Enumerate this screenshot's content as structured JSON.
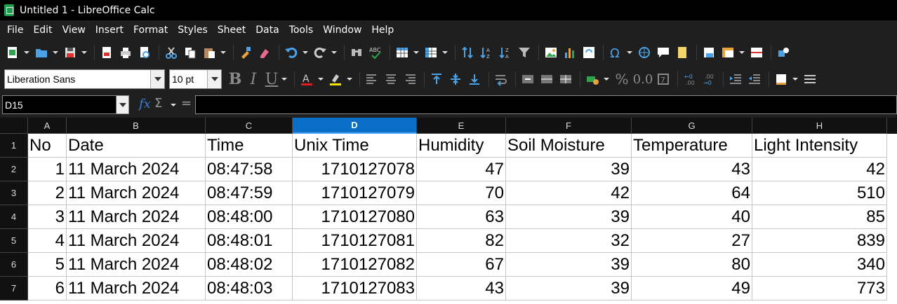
{
  "window": {
    "title": "Untitled 1 - LibreOffice Calc",
    "icon": "calc-icon"
  },
  "menu": [
    {
      "label": "File"
    },
    {
      "label": "Edit"
    },
    {
      "label": "View"
    },
    {
      "label": "Insert"
    },
    {
      "label": "Format"
    },
    {
      "label": "Styles"
    },
    {
      "label": "Sheet"
    },
    {
      "label": "Data"
    },
    {
      "label": "Tools"
    },
    {
      "label": "Window"
    },
    {
      "label": "Help"
    }
  ],
  "format_toolbar": {
    "font_name": "Liberation Sans",
    "font_size": "10 pt",
    "bold": "B",
    "italic": "I",
    "underline": "U",
    "percent": "%",
    "decimal": "0.0"
  },
  "formula_bar": {
    "name_box": "D15",
    "fx": "fx",
    "sigma": "Σ",
    "equals": "=",
    "content": ""
  },
  "sheet": {
    "active_column": "D",
    "columns": [
      "A",
      "B",
      "C",
      "D",
      "E",
      "F",
      "G",
      "H"
    ],
    "rows": [
      "1",
      "2",
      "3",
      "4",
      "5",
      "6",
      "7"
    ],
    "header": [
      "No",
      "Date",
      "Time",
      "Unix Time",
      "Humidity",
      "Soil Moisture",
      "Temperature",
      "Light Intensity"
    ],
    "data": [
      [
        "1",
        "11 March 2024",
        "08:47:58",
        "1710127078",
        "47",
        "39",
        "43",
        "42"
      ],
      [
        "2",
        "11 March 2024",
        "08:47:59",
        "1710127079",
        "70",
        "42",
        "64",
        "510"
      ],
      [
        "3",
        "11 March 2024",
        "08:48:00",
        "1710127080",
        "63",
        "39",
        "40",
        "85"
      ],
      [
        "4",
        "11 March 2024",
        "08:48:01",
        "1710127081",
        "82",
        "32",
        "27",
        "839"
      ],
      [
        "5",
        "11 March 2024",
        "08:48:02",
        "1710127082",
        "67",
        "39",
        "80",
        "340"
      ],
      [
        "6",
        "11 March 2024",
        "08:48:03",
        "1710127083",
        "43",
        "39",
        "49",
        "773"
      ]
    ]
  },
  "colors": {
    "active_column": "#0b6fc7",
    "toolbar_bg": "#1f1f1f",
    "title_bg": "#000000"
  }
}
